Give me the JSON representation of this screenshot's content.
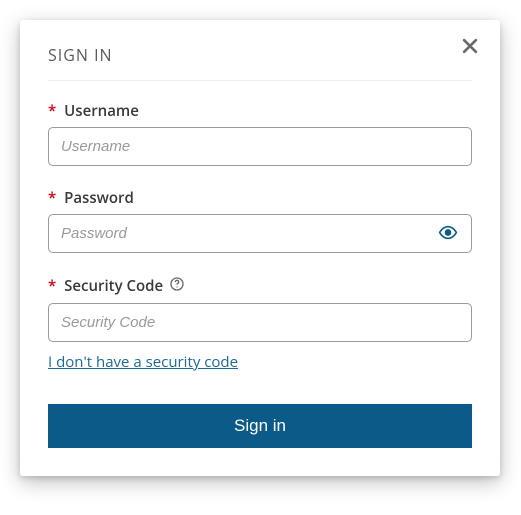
{
  "modal": {
    "title": "SIGN IN",
    "fields": {
      "username": {
        "label": "Username",
        "placeholder": "Username",
        "value": ""
      },
      "password": {
        "label": "Password",
        "placeholder": "Password",
        "value": ""
      },
      "security_code": {
        "label": "Security Code",
        "placeholder": "Security Code",
        "value": ""
      }
    },
    "no_code_link": "I don't have a security code",
    "submit_label": "Sign in"
  }
}
